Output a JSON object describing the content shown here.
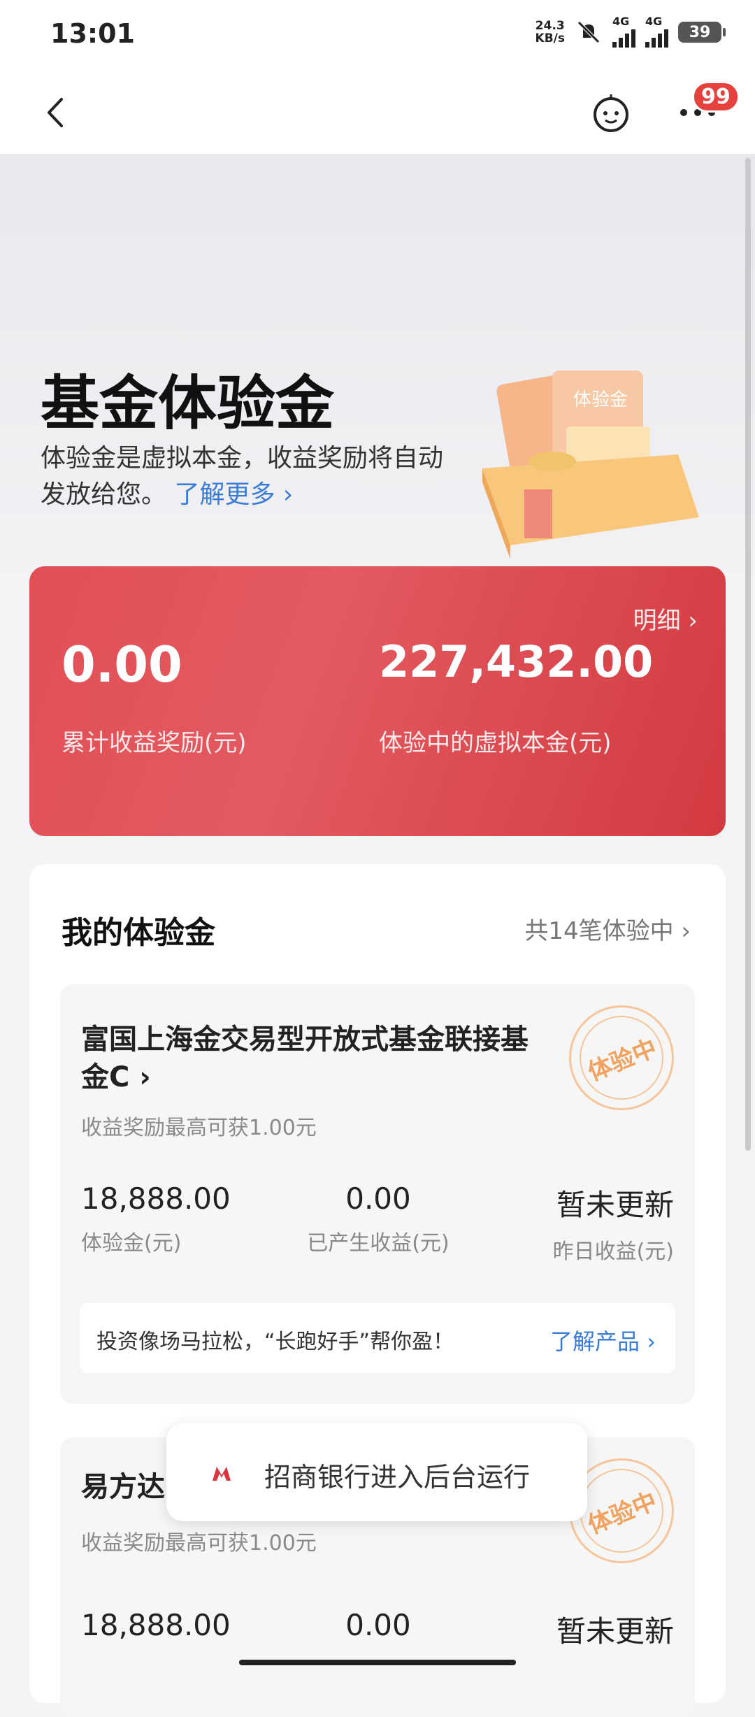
{
  "status_bar": {
    "time": "13:01",
    "net_speed_value": "24.3",
    "net_speed_unit": "KB/s",
    "signal1": "4G",
    "signal2": "4G",
    "battery": "39"
  },
  "nav": {
    "badge_count": "99"
  },
  "hero": {
    "title": "基金体验金",
    "desc": "体验金是虚拟本金，收益奖励将自动发放给您。",
    "learn_more": "了解更多 ›",
    "illustration_label": "体验金"
  },
  "summary": {
    "detail_link": "明细 ›",
    "cumulative_reward": "0.00",
    "cumulative_reward_label": "累计收益奖励(元)",
    "virtual_principal": "227,432.00",
    "virtual_principal_label": "体验中的虚拟本金(元)"
  },
  "my_experience": {
    "title": "我的体验金",
    "count_label": "共14笔体验中 ›",
    "funds": [
      {
        "name": "富国上海金交易型开放式基金联接基金C ›",
        "reward_note": "收益奖励最高可获1.00元",
        "stamp": "体验中",
        "amount": "18,888.00",
        "amount_label": "体验金(元)",
        "earned": "0.00",
        "earned_label": "已产生收益(元)",
        "yesterday": "暂未更新",
        "yesterday_label": "昨日收益(元)",
        "promo_text": "投资像场马拉松，“长跑好手”帮你盈！",
        "promo_link": "了解产品 ›"
      },
      {
        "name": "易方达",
        "reward_note": "收益奖励最高可获1.00元",
        "stamp": "体验中",
        "amount": "18,888.00",
        "earned": "0.00",
        "yesterday": "暂未更新"
      }
    ]
  },
  "toast": {
    "text": "招商银行进入后台运行"
  },
  "colors": {
    "accent_red": "#e14f55",
    "link_blue": "#3a7bd5",
    "stamp_orange": "#f0a25e"
  }
}
